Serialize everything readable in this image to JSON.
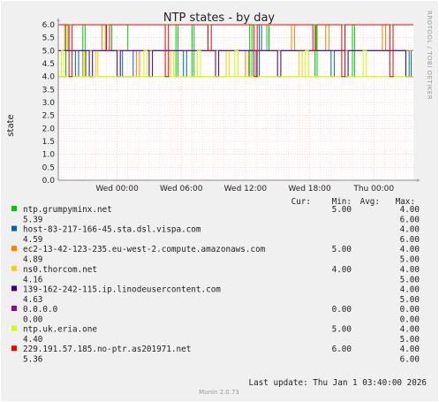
{
  "chart_data": {
    "type": "line",
    "title": "NTP states - by day",
    "ylabel": "state",
    "ylim": [
      0,
      6
    ],
    "yticks": [
      "0.0",
      "0.5",
      "1.0",
      "1.5",
      "2.0",
      "2.5",
      "3.0",
      "3.5",
      "4.0",
      "4.5",
      "5.0",
      "5.5",
      "6.0"
    ],
    "xticks": [
      "Wed 00:00",
      "Wed 06:00",
      "Wed 12:00",
      "Wed 18:00",
      "Thu 00:00"
    ],
    "xtick_hours": [
      0,
      6,
      12,
      18,
      24
    ],
    "xrange_hours": [
      -5.5,
      27.7
    ],
    "grid": true,
    "side_text": "RRDTOOL / TOBI OETIKER",
    "legend_headers": {
      "cur": "Cur:",
      "min": "Min:",
      "avg": "Avg:",
      "max": "Max:"
    },
    "series": [
      {
        "name": "ntp.grumpyminx.net",
        "color": "#00cc00",
        "cur": "5.00",
        "min": "4.00",
        "avg": "5.39",
        "max": "6.00",
        "points": [
          [
            -5.5,
            4
          ],
          [
            -4.8,
            6
          ],
          [
            -3.2,
            4
          ],
          [
            -3.0,
            6
          ],
          [
            -0.5,
            5
          ],
          [
            1.0,
            6
          ],
          [
            5.5,
            4
          ],
          [
            5.7,
            6
          ],
          [
            7.0,
            4
          ],
          [
            7.2,
            6
          ],
          [
            12.4,
            4
          ],
          [
            12.6,
            6
          ],
          [
            14.0,
            5
          ],
          [
            14.2,
            6
          ],
          [
            18.5,
            4
          ],
          [
            18.7,
            6
          ],
          [
            22.0,
            4
          ],
          [
            22.2,
            6
          ],
          [
            27.7,
            6
          ]
        ]
      },
      {
        "name": "host-83-217-166-45.sta.dsl.vispa.com",
        "color": "#0066b3",
        "cur": "",
        "min": "4.00",
        "avg": "4.59",
        "max": "6.00",
        "points": [
          [
            -5.5,
            5
          ],
          [
            -3.9,
            4
          ],
          [
            -3.6,
            5
          ],
          [
            0.5,
            4
          ],
          [
            1.5,
            5
          ],
          [
            6.2,
            4
          ],
          [
            6.5,
            5
          ],
          [
            13.0,
            4
          ],
          [
            13.3,
            6
          ],
          [
            13.5,
            5
          ],
          [
            20.0,
            4
          ],
          [
            20.3,
            5
          ],
          [
            27.3,
            4
          ],
          [
            27.5,
            5
          ],
          [
            27.7,
            5
          ]
        ]
      },
      {
        "name": "ec2-13-42-123-235.eu-west-2.compute.amazonaws.com",
        "color": "#ff8000",
        "cur": "5.00",
        "min": "4.00",
        "avg": "4.89",
        "max": "5.00",
        "points": [
          [
            -5.5,
            5
          ],
          [
            -4.9,
            6
          ],
          [
            -4.6,
            5
          ],
          [
            -3.2,
            4
          ],
          [
            -2.9,
            5
          ],
          [
            -1.4,
            6
          ],
          [
            -1.1,
            5
          ],
          [
            1.8,
            4
          ],
          [
            2.1,
            5
          ],
          [
            12.0,
            4
          ],
          [
            12.3,
            5
          ],
          [
            16.3,
            6
          ],
          [
            16.6,
            5
          ],
          [
            19.5,
            6
          ],
          [
            19.8,
            5
          ],
          [
            24.8,
            6
          ],
          [
            25.1,
            5
          ],
          [
            27.7,
            5
          ]
        ]
      },
      {
        "name": "ns0.thorcom.net",
        "color": "#ffcc00",
        "cur": "4.00",
        "min": "4.00",
        "avg": "4.16",
        "max": "5.00",
        "points": [
          [
            -5.5,
            4
          ],
          [
            -2.0,
            5
          ],
          [
            -1.8,
            4
          ],
          [
            5.0,
            5
          ],
          [
            5.3,
            4
          ],
          [
            10.2,
            5
          ],
          [
            10.5,
            4
          ],
          [
            17.0,
            5
          ],
          [
            17.3,
            4
          ],
          [
            27.7,
            4
          ]
        ]
      },
      {
        "name": "139-162-242-115.ip.linodeusercontent.com",
        "color": "#330099",
        "cur": "",
        "min": "4.00",
        "avg": "4.63",
        "max": "5.00",
        "points": [
          [
            -5.5,
            5
          ],
          [
            -2.6,
            4
          ],
          [
            -2.3,
            5
          ],
          [
            0.0,
            4
          ],
          [
            0.3,
            5
          ],
          [
            3.0,
            4
          ],
          [
            3.3,
            5
          ],
          [
            9.2,
            4
          ],
          [
            9.5,
            5
          ],
          [
            15.0,
            4
          ],
          [
            15.3,
            5
          ],
          [
            21.3,
            4
          ],
          [
            21.6,
            5
          ],
          [
            27.0,
            4
          ],
          [
            27.7,
            4
          ]
        ]
      },
      {
        "name": "0.0.0.0",
        "color": "#990099",
        "cur": "0.00",
        "min": "0.00",
        "avg": "0.00",
        "max": "0.00",
        "points": []
      },
      {
        "name": "ntp.uk.eria.one",
        "color": "#ccff00",
        "cur": "5.00",
        "min": "4.00",
        "avg": "4.40",
        "max": "5.00",
        "points": [
          [
            -5.5,
            4
          ],
          [
            -5.2,
            5
          ],
          [
            -5.0,
            4
          ],
          [
            2.5,
            5
          ],
          [
            2.8,
            4
          ],
          [
            7.5,
            5
          ],
          [
            7.8,
            4
          ],
          [
            11.0,
            5
          ],
          [
            11.3,
            4
          ],
          [
            17.6,
            5
          ],
          [
            17.9,
            4
          ],
          [
            23.0,
            5
          ],
          [
            23.3,
            4
          ],
          [
            27.7,
            4
          ]
        ]
      },
      {
        "name": "229.191.57.185.no-ptr.as201971.net",
        "color": "#ff0000",
        "cur": "6.00",
        "min": "4.00",
        "avg": "5.36",
        "max": "6.00",
        "points": [
          [
            -5.5,
            6
          ],
          [
            -4.5,
            4
          ],
          [
            -4.2,
            6
          ],
          [
            -1.0,
            5
          ],
          [
            -0.7,
            6
          ],
          [
            4.5,
            4
          ],
          [
            4.8,
            6
          ],
          [
            8.5,
            5
          ],
          [
            8.8,
            6
          ],
          [
            12.8,
            4
          ],
          [
            13.1,
            6
          ],
          [
            18.3,
            5
          ],
          [
            18.6,
            6
          ],
          [
            21.0,
            4
          ],
          [
            21.3,
            6
          ],
          [
            25.5,
            4
          ],
          [
            25.8,
            6
          ],
          [
            27.7,
            6
          ]
        ]
      }
    ]
  },
  "footer": {
    "last_update": "Last update: Thu Jan  1 03:40:00 2026",
    "munin": "Munin 2.0.73"
  }
}
